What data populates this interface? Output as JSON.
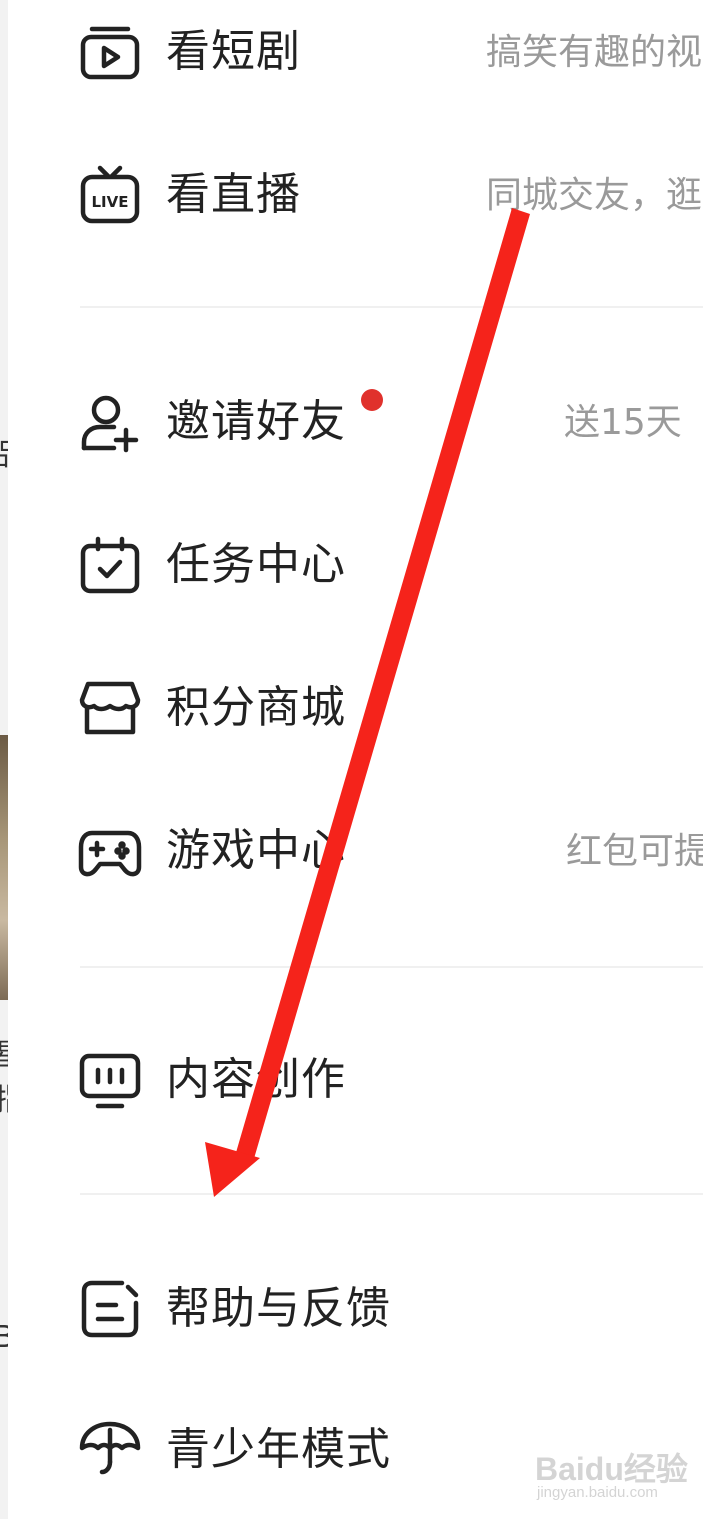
{
  "menu": {
    "items": [
      {
        "id": "short-drama",
        "label": "看短剧",
        "subtitle": "搞笑有趣的视",
        "icon": "play-card-icon",
        "badge": false
      },
      {
        "id": "live",
        "label": "看直播",
        "subtitle": "同城交友，逛",
        "icon": "live-tv-icon",
        "badge": false
      },
      {
        "id": "invite",
        "label": "邀请好友",
        "subtitle": "送15天",
        "icon": "add-user-icon",
        "badge": true
      },
      {
        "id": "tasks",
        "label": "任务中心",
        "subtitle": "",
        "icon": "calendar-check-icon",
        "badge": false
      },
      {
        "id": "points-mall",
        "label": "积分商城",
        "subtitle": "",
        "icon": "store-icon",
        "badge": false
      },
      {
        "id": "game-center",
        "label": "游戏中心",
        "subtitle": "红包可提",
        "icon": "gamepad-icon",
        "badge": false
      },
      {
        "id": "creation",
        "label": "内容创作",
        "subtitle": "",
        "icon": "monitor-icon",
        "badge": false
      },
      {
        "id": "help",
        "label": "帮助与反馈",
        "subtitle": "",
        "icon": "feedback-icon",
        "badge": false
      },
      {
        "id": "teen-mode",
        "label": "青少年模式",
        "subtitle": "",
        "icon": "sprout-umbrella-icon",
        "badge": false
      }
    ]
  },
  "background_strip": {
    "chars": [
      "品",
      "星",
      "指",
      "B"
    ]
  },
  "annotation": {
    "arrow_color": "#f5231b"
  },
  "watermark": {
    "brand": "Baidu经验",
    "url": "jingyan.baidu.com"
  },
  "colors": {
    "label": "#222222",
    "subtitle": "#9a9a9a",
    "badge": "#e0312c",
    "divider": "#f0f0f0"
  }
}
